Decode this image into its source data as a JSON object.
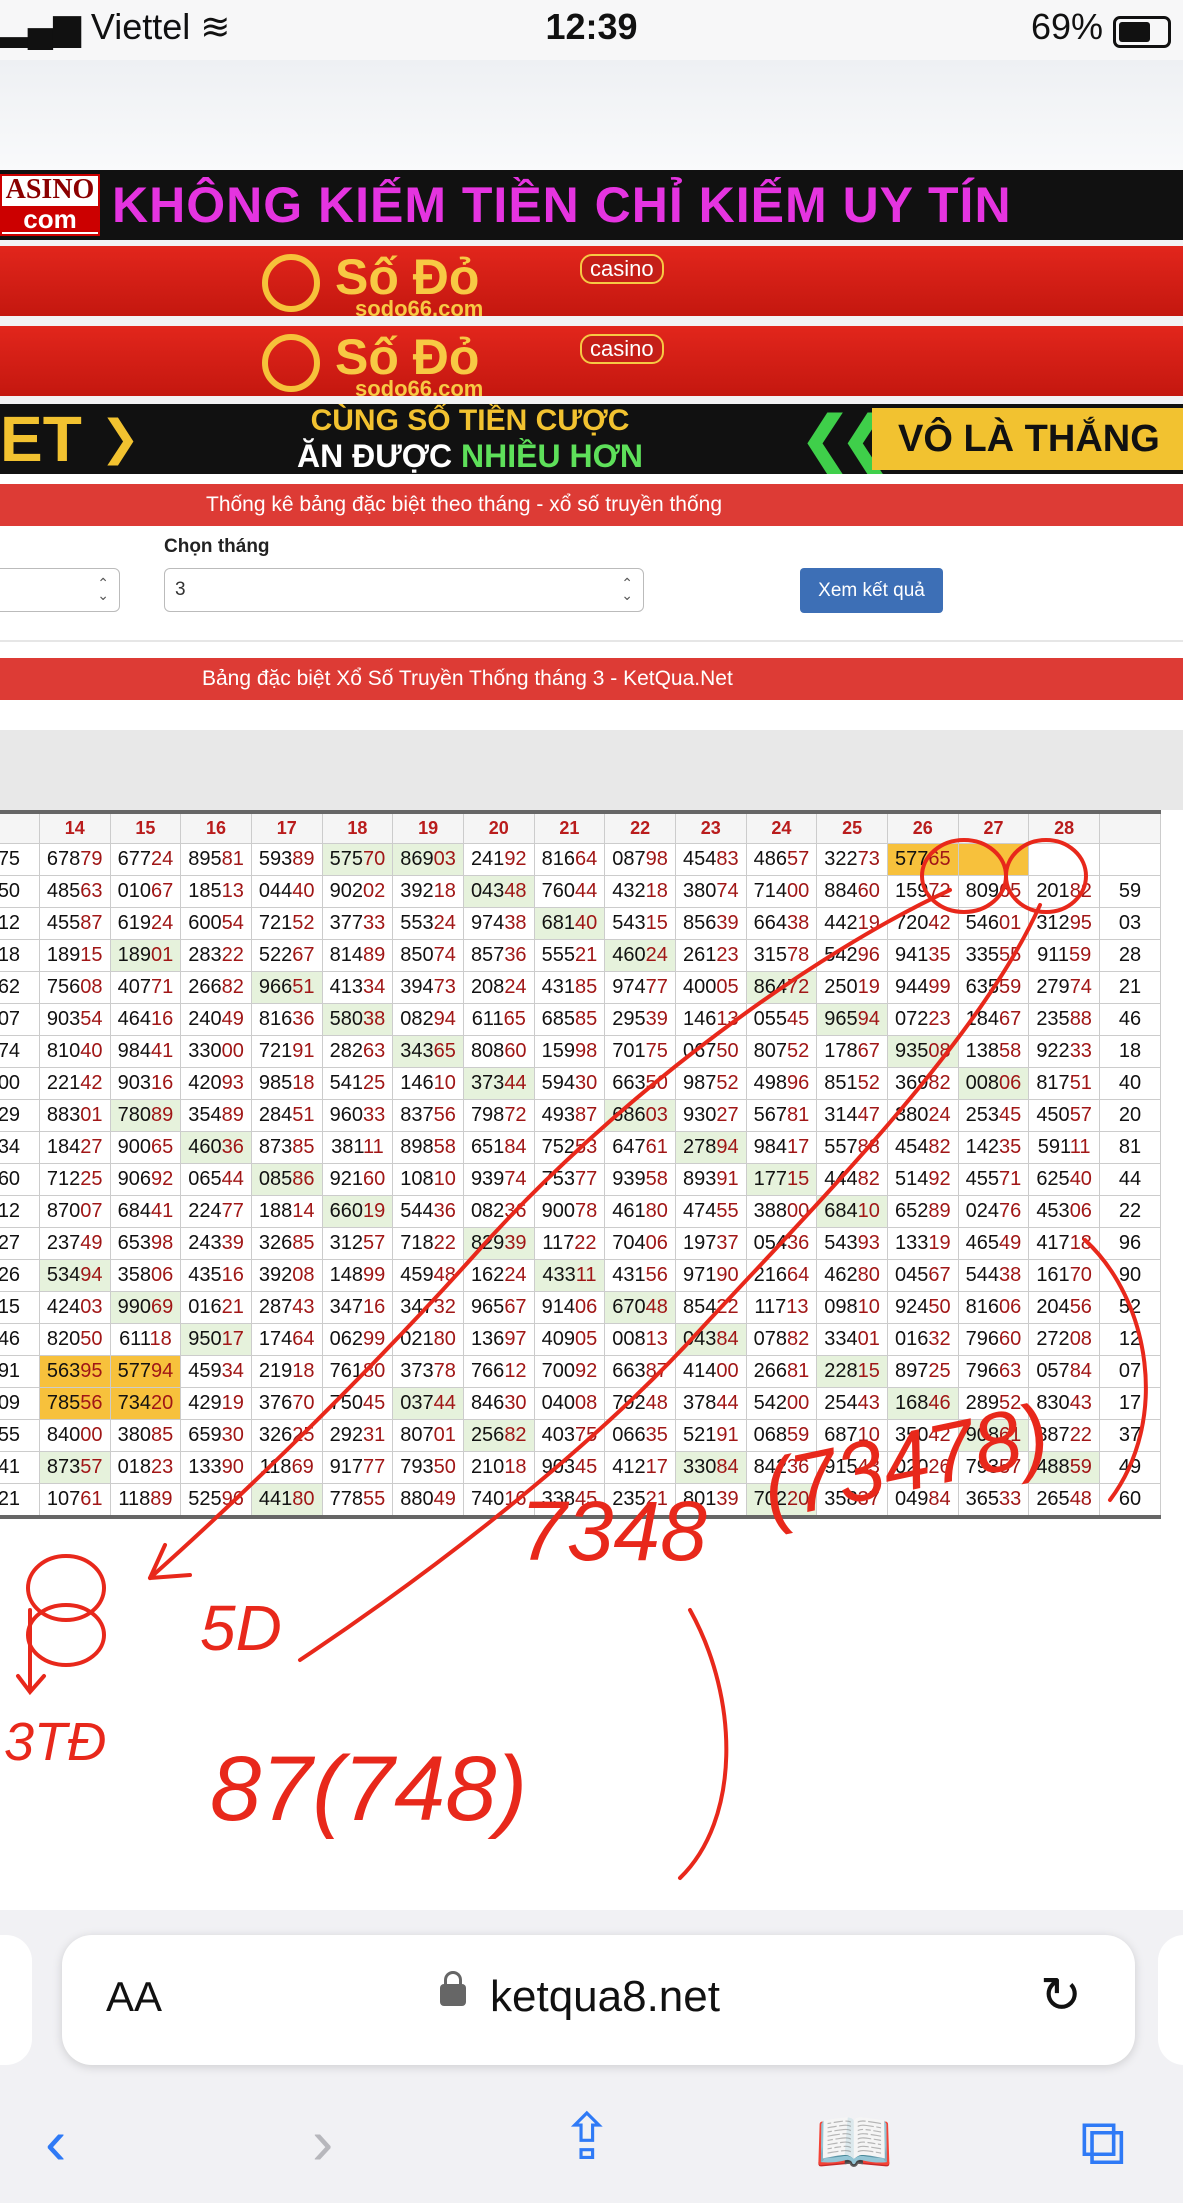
{
  "status": {
    "carrier": "Viettel",
    "time": "12:39",
    "battery": "69%"
  },
  "banners": {
    "casino_logo_top": "ASINO",
    "casino_logo_bottom": "com",
    "casino_slogan": "KHÔNG KIẾM TIỀN CHỈ KIẾM UY TÍN",
    "sodo_brand": "Số Đỏ",
    "sodo_casino": "casino",
    "sodo_site": "sodo66.com",
    "bet_left": "ET",
    "bet_line1": "CÙNG SỐ TIỀN CƯỢC",
    "bet_line2_a": "ĂN ĐƯỢC ",
    "bet_line2_b": "NHIỀU HƠN",
    "bet_right": "VÔ LÀ THẮNG"
  },
  "form": {
    "header": "Thống kê bảng đặc biệt theo tháng - xổ số truyền thống",
    "month_label": "Chọn tháng",
    "month_value": "3",
    "submit": "Xem kết quả"
  },
  "table_title": "Bảng đặc biệt Xổ Số Truyền Thống tháng 3 - KetQua.Net",
  "table": {
    "columns": [
      "",
      "14",
      "15",
      "16",
      "17",
      "18",
      "19",
      "20",
      "21",
      "22",
      "23",
      "24",
      "25",
      "26",
      "27",
      "28",
      ""
    ],
    "rows": [
      [
        "75",
        "67879",
        "67724",
        "89581",
        "59389",
        "57570",
        "86903",
        "24192",
        "81664",
        "08798",
        "45483",
        "48657",
        "32273",
        "57765",
        "",
        ""
      ],
      [
        "50",
        "48563",
        "01067",
        "18513",
        "04440",
        "90202",
        "39218",
        "04348",
        "76044",
        "43218",
        "38074",
        "71400",
        "88460",
        "15972",
        "80965",
        "20182",
        "59"
      ],
      [
        "12",
        "45587",
        "61924",
        "60054",
        "72152",
        "37733",
        "55324",
        "97438",
        "68140",
        "54315",
        "85639",
        "66438",
        "44219",
        "72042",
        "54601",
        "31295",
        "03"
      ],
      [
        "18",
        "18915",
        "18901",
        "28322",
        "52267",
        "81489",
        "85074",
        "85736",
        "55521",
        "46024",
        "26123",
        "31578",
        "54296",
        "94135",
        "33555",
        "91159",
        "28"
      ],
      [
        "62",
        "75608",
        "40771",
        "26682",
        "96651",
        "41334",
        "39473",
        "20824",
        "43185",
        "97477",
        "40005",
        "86472",
        "25019",
        "94499",
        "63559",
        "27974",
        "21"
      ],
      [
        "07",
        "90354",
        "46416",
        "24049",
        "81636",
        "58038",
        "08294",
        "61165",
        "68585",
        "29539",
        "14613",
        "05545",
        "96594",
        "07223",
        "18467",
        "23588",
        "46"
      ],
      [
        "74",
        "81040",
        "98441",
        "33000",
        "72191",
        "28263",
        "34365",
        "80860",
        "15998",
        "70175",
        "06750",
        "80752",
        "17867",
        "93508",
        "13858",
        "92233",
        "18"
      ],
      [
        "00",
        "22142",
        "90316",
        "42093",
        "98518",
        "54125",
        "14610",
        "37344",
        "59430",
        "66350",
        "98752",
        "49896",
        "85152",
        "36982",
        "00806",
        "81751",
        "40"
      ],
      [
        "29",
        "88301",
        "78089",
        "35489",
        "28451",
        "96033",
        "83756",
        "79872",
        "49387",
        "68603",
        "93027",
        "56781",
        "31447",
        "38024",
        "25345",
        "45057",
        "20"
      ],
      [
        "34",
        "18427",
        "90065",
        "46036",
        "87385",
        "38111",
        "89858",
        "65184",
        "75253",
        "64761",
        "27894",
        "98417",
        "55788",
        "45482",
        "14235",
        "59111",
        "81"
      ],
      [
        "60",
        "71225",
        "90692",
        "06544",
        "08586",
        "92160",
        "10810",
        "93974",
        "75377",
        "93958",
        "89391",
        "17715",
        "44482",
        "51492",
        "45571",
        "62540",
        "44"
      ],
      [
        "12",
        "87007",
        "68441",
        "22477",
        "18814",
        "66019",
        "54436",
        "08236",
        "90078",
        "46180",
        "47455",
        "38800",
        "68410",
        "65289",
        "02476",
        "45306",
        "22"
      ],
      [
        "27",
        "23749",
        "65398",
        "24339",
        "32685",
        "31257",
        "71822",
        "82939",
        "11722",
        "70406",
        "19737",
        "05436",
        "54393",
        "13319",
        "46549",
        "41718",
        "96"
      ],
      [
        "26",
        "53494",
        "35806",
        "43516",
        "39208",
        "14899",
        "45948",
        "16224",
        "43311",
        "43156",
        "97190",
        "21664",
        "46280",
        "04567",
        "54438",
        "16170",
        "90"
      ],
      [
        "15",
        "42403",
        "99069",
        "01621",
        "28743",
        "34716",
        "34732",
        "96567",
        "91406",
        "67048",
        "85422",
        "11713",
        "09810",
        "92450",
        "81606",
        "20456",
        "52"
      ],
      [
        "46",
        "82050",
        "61118",
        "95017",
        "17464",
        "06299",
        "02180",
        "13697",
        "40905",
        "00813",
        "04384",
        "07882",
        "33401",
        "01632",
        "79660",
        "27208",
        "12"
      ],
      [
        "91",
        "56395",
        "57794",
        "45934",
        "21918",
        "76180",
        "37378",
        "76612",
        "70092",
        "66387",
        "41400",
        "26681",
        "22815",
        "89725",
        "79663",
        "05784",
        "07"
      ],
      [
        "09",
        "78556",
        "73420",
        "42919",
        "37670",
        "75045",
        "03744",
        "84630",
        "04008",
        "79248",
        "37844",
        "54200",
        "25443",
        "16846",
        "28952",
        "83043",
        "17"
      ],
      [
        "55",
        "84000",
        "38085",
        "65930",
        "32625",
        "29231",
        "80701",
        "25682",
        "40375",
        "06635",
        "52191",
        "06859",
        "68710",
        "35042",
        "90861",
        "38722",
        "37"
      ],
      [
        "41",
        "87357",
        "01823",
        "13390",
        "11869",
        "91777",
        "79350",
        "21018",
        "90345",
        "41217",
        "33084",
        "84236",
        "91543",
        "02026",
        "79357",
        "48859",
        "49"
      ],
      [
        "21",
        "10761",
        "11889",
        "52596",
        "44180",
        "77855",
        "88049",
        "74016",
        "33845",
        "23521",
        "80139",
        "70220",
        "35837",
        "04984",
        "36533",
        "26548",
        "60"
      ]
    ]
  },
  "annotations": {
    "row_note": "7348",
    "row_note_2": "(73478)",
    "bottom_note": "87(748)",
    "mid_note": "5D",
    "left_note": "3TĐ"
  },
  "safari": {
    "text_size": "AA",
    "url": "ketqua8.net"
  },
  "colors": {
    "red_bar": "#dd3b35",
    "highlight": "#f7c13c",
    "green_cell": "#e6f2dc",
    "button": "#3d6fb6",
    "ink": "#e8281b"
  }
}
